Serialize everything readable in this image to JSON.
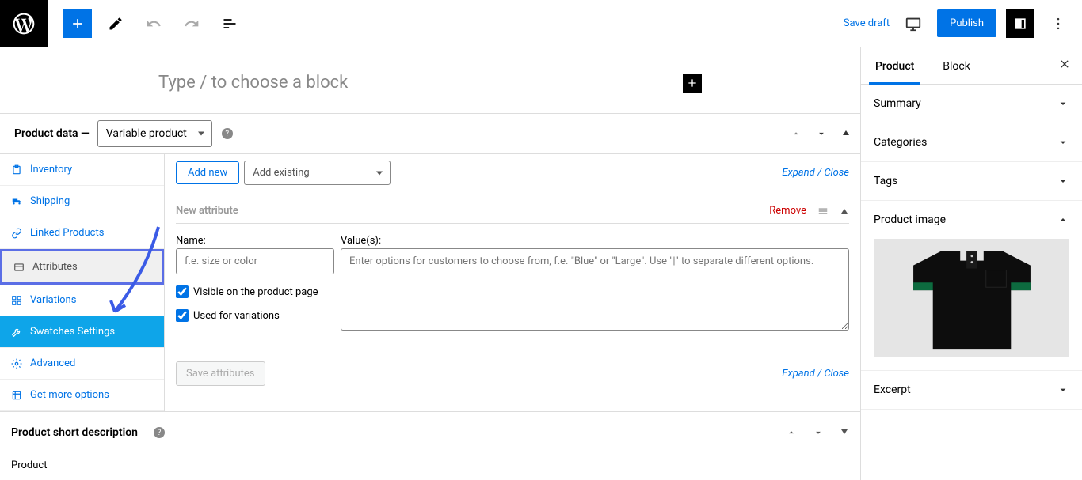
{
  "topbar": {
    "save_draft": "Save draft",
    "publish": "Publish"
  },
  "editor": {
    "block_prompt": "Type / to choose a block"
  },
  "product_data": {
    "label": "Product data —",
    "type_selected": "Variable product",
    "tabs": {
      "inventory": "Inventory",
      "shipping": "Shipping",
      "linked": "Linked Products",
      "attributes": "Attributes",
      "variations": "Variations",
      "swatches": "Swatches Settings",
      "advanced": "Advanced",
      "more": "Get more options"
    }
  },
  "attributes": {
    "add_new": "Add new",
    "add_existing_placeholder": "Add existing",
    "expand_close": "Expand / Close",
    "new_attribute": "New attribute",
    "remove": "Remove",
    "name_label": "Name:",
    "name_placeholder": "f.e. size or color",
    "values_label": "Value(s):",
    "values_placeholder": "Enter options for customers to choose from, f.e. \"Blue\" or \"Large\". Use \"|\" to separate different options.",
    "visible_cb": "Visible on the product page",
    "used_cb": "Used for variations",
    "save_btn": "Save attributes"
  },
  "short_desc": {
    "label": "Product short description",
    "footer": "Product"
  },
  "right_panel": {
    "tab_product": "Product",
    "tab_block": "Block",
    "sections": {
      "summary": "Summary",
      "categories": "Categories",
      "tags": "Tags",
      "product_image": "Product image",
      "excerpt": "Excerpt"
    }
  }
}
